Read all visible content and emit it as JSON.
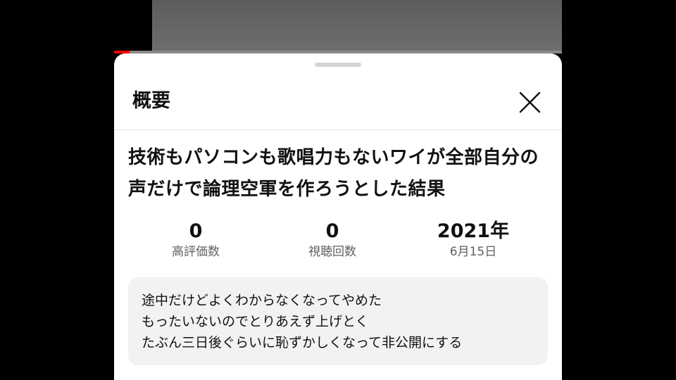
{
  "player": {
    "progress_fraction": 0.035
  },
  "panel": {
    "title": "概要",
    "close_icon": "close-icon"
  },
  "video": {
    "title": "技術もパソコンも歌唱力もないワイが全部自分の声だけで論理空軍を作ろうとした結果"
  },
  "stats": [
    {
      "value": "0",
      "label": "高評価数"
    },
    {
      "value": "0",
      "label": "視聴回数"
    },
    {
      "value": "2021年",
      "label": "6月15日"
    }
  ],
  "description": {
    "text": "途中だけどよくわからなくなってやめた\nもったいないのでとりあえず上げとく\nたぶん三日後ぐらいに恥ずかしくなって非公開にする"
  },
  "colors": {
    "accent": "#ff0000",
    "sheet_background": "#ffffff",
    "description_background": "#f2f2f2",
    "secondary_text": "#606060"
  }
}
